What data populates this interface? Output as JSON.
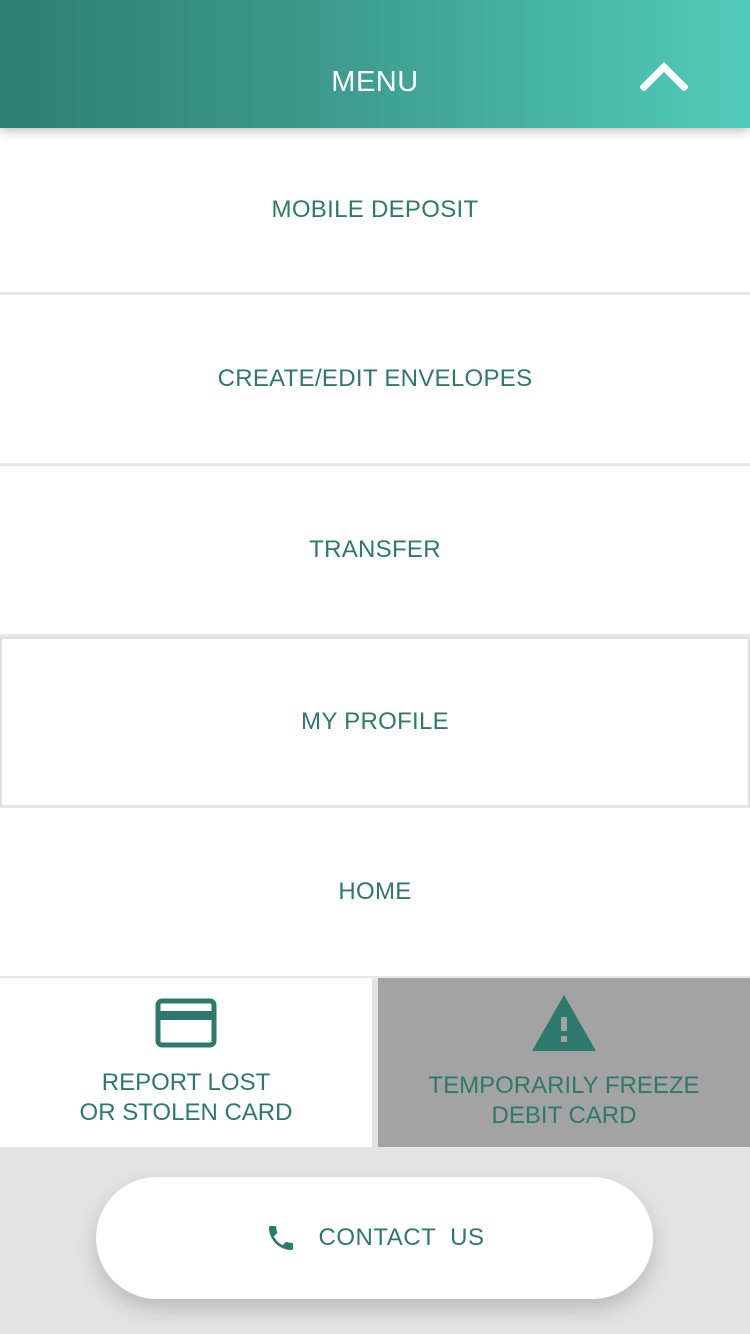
{
  "header": {
    "title": "MENU",
    "collapse_icon": "chevron-up-icon"
  },
  "menu": {
    "items": [
      {
        "label": "MOBILE DEPOSIT"
      },
      {
        "label": "CREATE/EDIT ENVELOPES"
      },
      {
        "label": "TRANSFER"
      },
      {
        "label": "MY PROFILE"
      },
      {
        "label": "HOME"
      }
    ]
  },
  "cards": {
    "report": {
      "icon": "credit-card-icon",
      "line1": "REPORT LOST",
      "line2": "OR STOLEN CARD"
    },
    "freeze": {
      "icon": "warning-icon",
      "line1": "TEMPORARILY FREEZE",
      "line2": "DEBIT CARD"
    }
  },
  "contact": {
    "icon": "phone-icon",
    "label": "CONTACT  US"
  },
  "colors": {
    "accent": "#2d7a6d",
    "header_gradient_start": "#2c7f70",
    "header_gradient_end": "#50cbbb",
    "disabled_bg": "#a3a3a3",
    "page_bg": "#e3e3e3"
  }
}
